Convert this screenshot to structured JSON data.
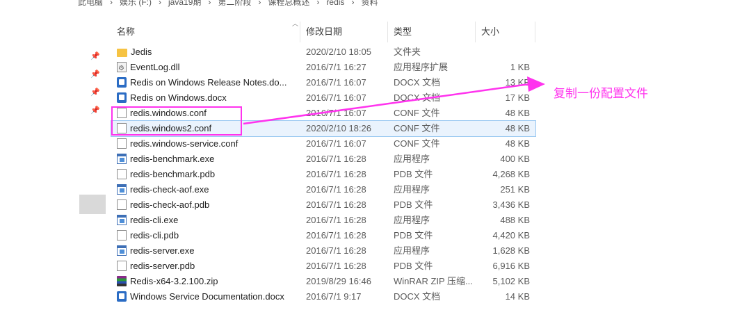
{
  "breadcrumb": [
    "此电脑",
    "›",
    "娱乐 (F:)",
    "›",
    "java19期",
    "›",
    "第二阶段",
    "›",
    "课程总概述",
    "›",
    "redis",
    "›",
    "资料"
  ],
  "columns": {
    "name": "名称",
    "date": "修改日期",
    "type": "类型",
    "size": "大小"
  },
  "files": [
    {
      "icon": "folder-icon",
      "name": "Jedis",
      "date": "2020/2/10 18:05",
      "type": "文件夹",
      "size": ""
    },
    {
      "icon": "dll-icon",
      "name": "EventLog.dll",
      "date": "2016/7/1 16:27",
      "type": "应用程序扩展",
      "size": "1 KB"
    },
    {
      "icon": "docx-icon",
      "name": "Redis on Windows Release Notes.do...",
      "date": "2016/7/1 16:07",
      "type": "DOCX 文档",
      "size": "13 KB"
    },
    {
      "icon": "docx-icon",
      "name": "Redis on Windows.docx",
      "date": "2016/7/1 16:07",
      "type": "DOCX 文档",
      "size": "17 KB"
    },
    {
      "icon": "file-icon",
      "name": "redis.windows.conf",
      "date": "2016/7/1 16:07",
      "type": "CONF 文件",
      "size": "48 KB"
    },
    {
      "icon": "file-icon",
      "name": "redis.windows2.conf",
      "date": "2020/2/10 18:26",
      "type": "CONF 文件",
      "size": "48 KB",
      "selected": true
    },
    {
      "icon": "file-icon",
      "name": "redis.windows-service.conf",
      "date": "2016/7/1 16:07",
      "type": "CONF 文件",
      "size": "48 KB"
    },
    {
      "icon": "exe-icon",
      "name": "redis-benchmark.exe",
      "date": "2016/7/1 16:28",
      "type": "应用程序",
      "size": "400 KB"
    },
    {
      "icon": "file-icon",
      "name": "redis-benchmark.pdb",
      "date": "2016/7/1 16:28",
      "type": "PDB 文件",
      "size": "4,268 KB"
    },
    {
      "icon": "exe-icon",
      "name": "redis-check-aof.exe",
      "date": "2016/7/1 16:28",
      "type": "应用程序",
      "size": "251 KB"
    },
    {
      "icon": "file-icon",
      "name": "redis-check-aof.pdb",
      "date": "2016/7/1 16:28",
      "type": "PDB 文件",
      "size": "3,436 KB"
    },
    {
      "icon": "exe-icon",
      "name": "redis-cli.exe",
      "date": "2016/7/1 16:28",
      "type": "应用程序",
      "size": "488 KB"
    },
    {
      "icon": "file-icon",
      "name": "redis-cli.pdb",
      "date": "2016/7/1 16:28",
      "type": "PDB 文件",
      "size": "4,420 KB"
    },
    {
      "icon": "exe-icon",
      "name": "redis-server.exe",
      "date": "2016/7/1 16:28",
      "type": "应用程序",
      "size": "1,628 KB"
    },
    {
      "icon": "file-icon",
      "name": "redis-server.pdb",
      "date": "2016/7/1 16:28",
      "type": "PDB 文件",
      "size": "6,916 KB"
    },
    {
      "icon": "zip-icon",
      "name": "Redis-x64-3.2.100.zip",
      "date": "2019/8/29 16:46",
      "type": "WinRAR ZIP 压缩...",
      "size": "5,102 KB"
    },
    {
      "icon": "docx-icon",
      "name": "Windows Service Documentation.docx",
      "date": "2016/7/1 9:17",
      "type": "DOCX 文档",
      "size": "14 KB"
    }
  ],
  "annotation": {
    "text": "复制一份配置文件",
    "color": "#ff33ee"
  }
}
